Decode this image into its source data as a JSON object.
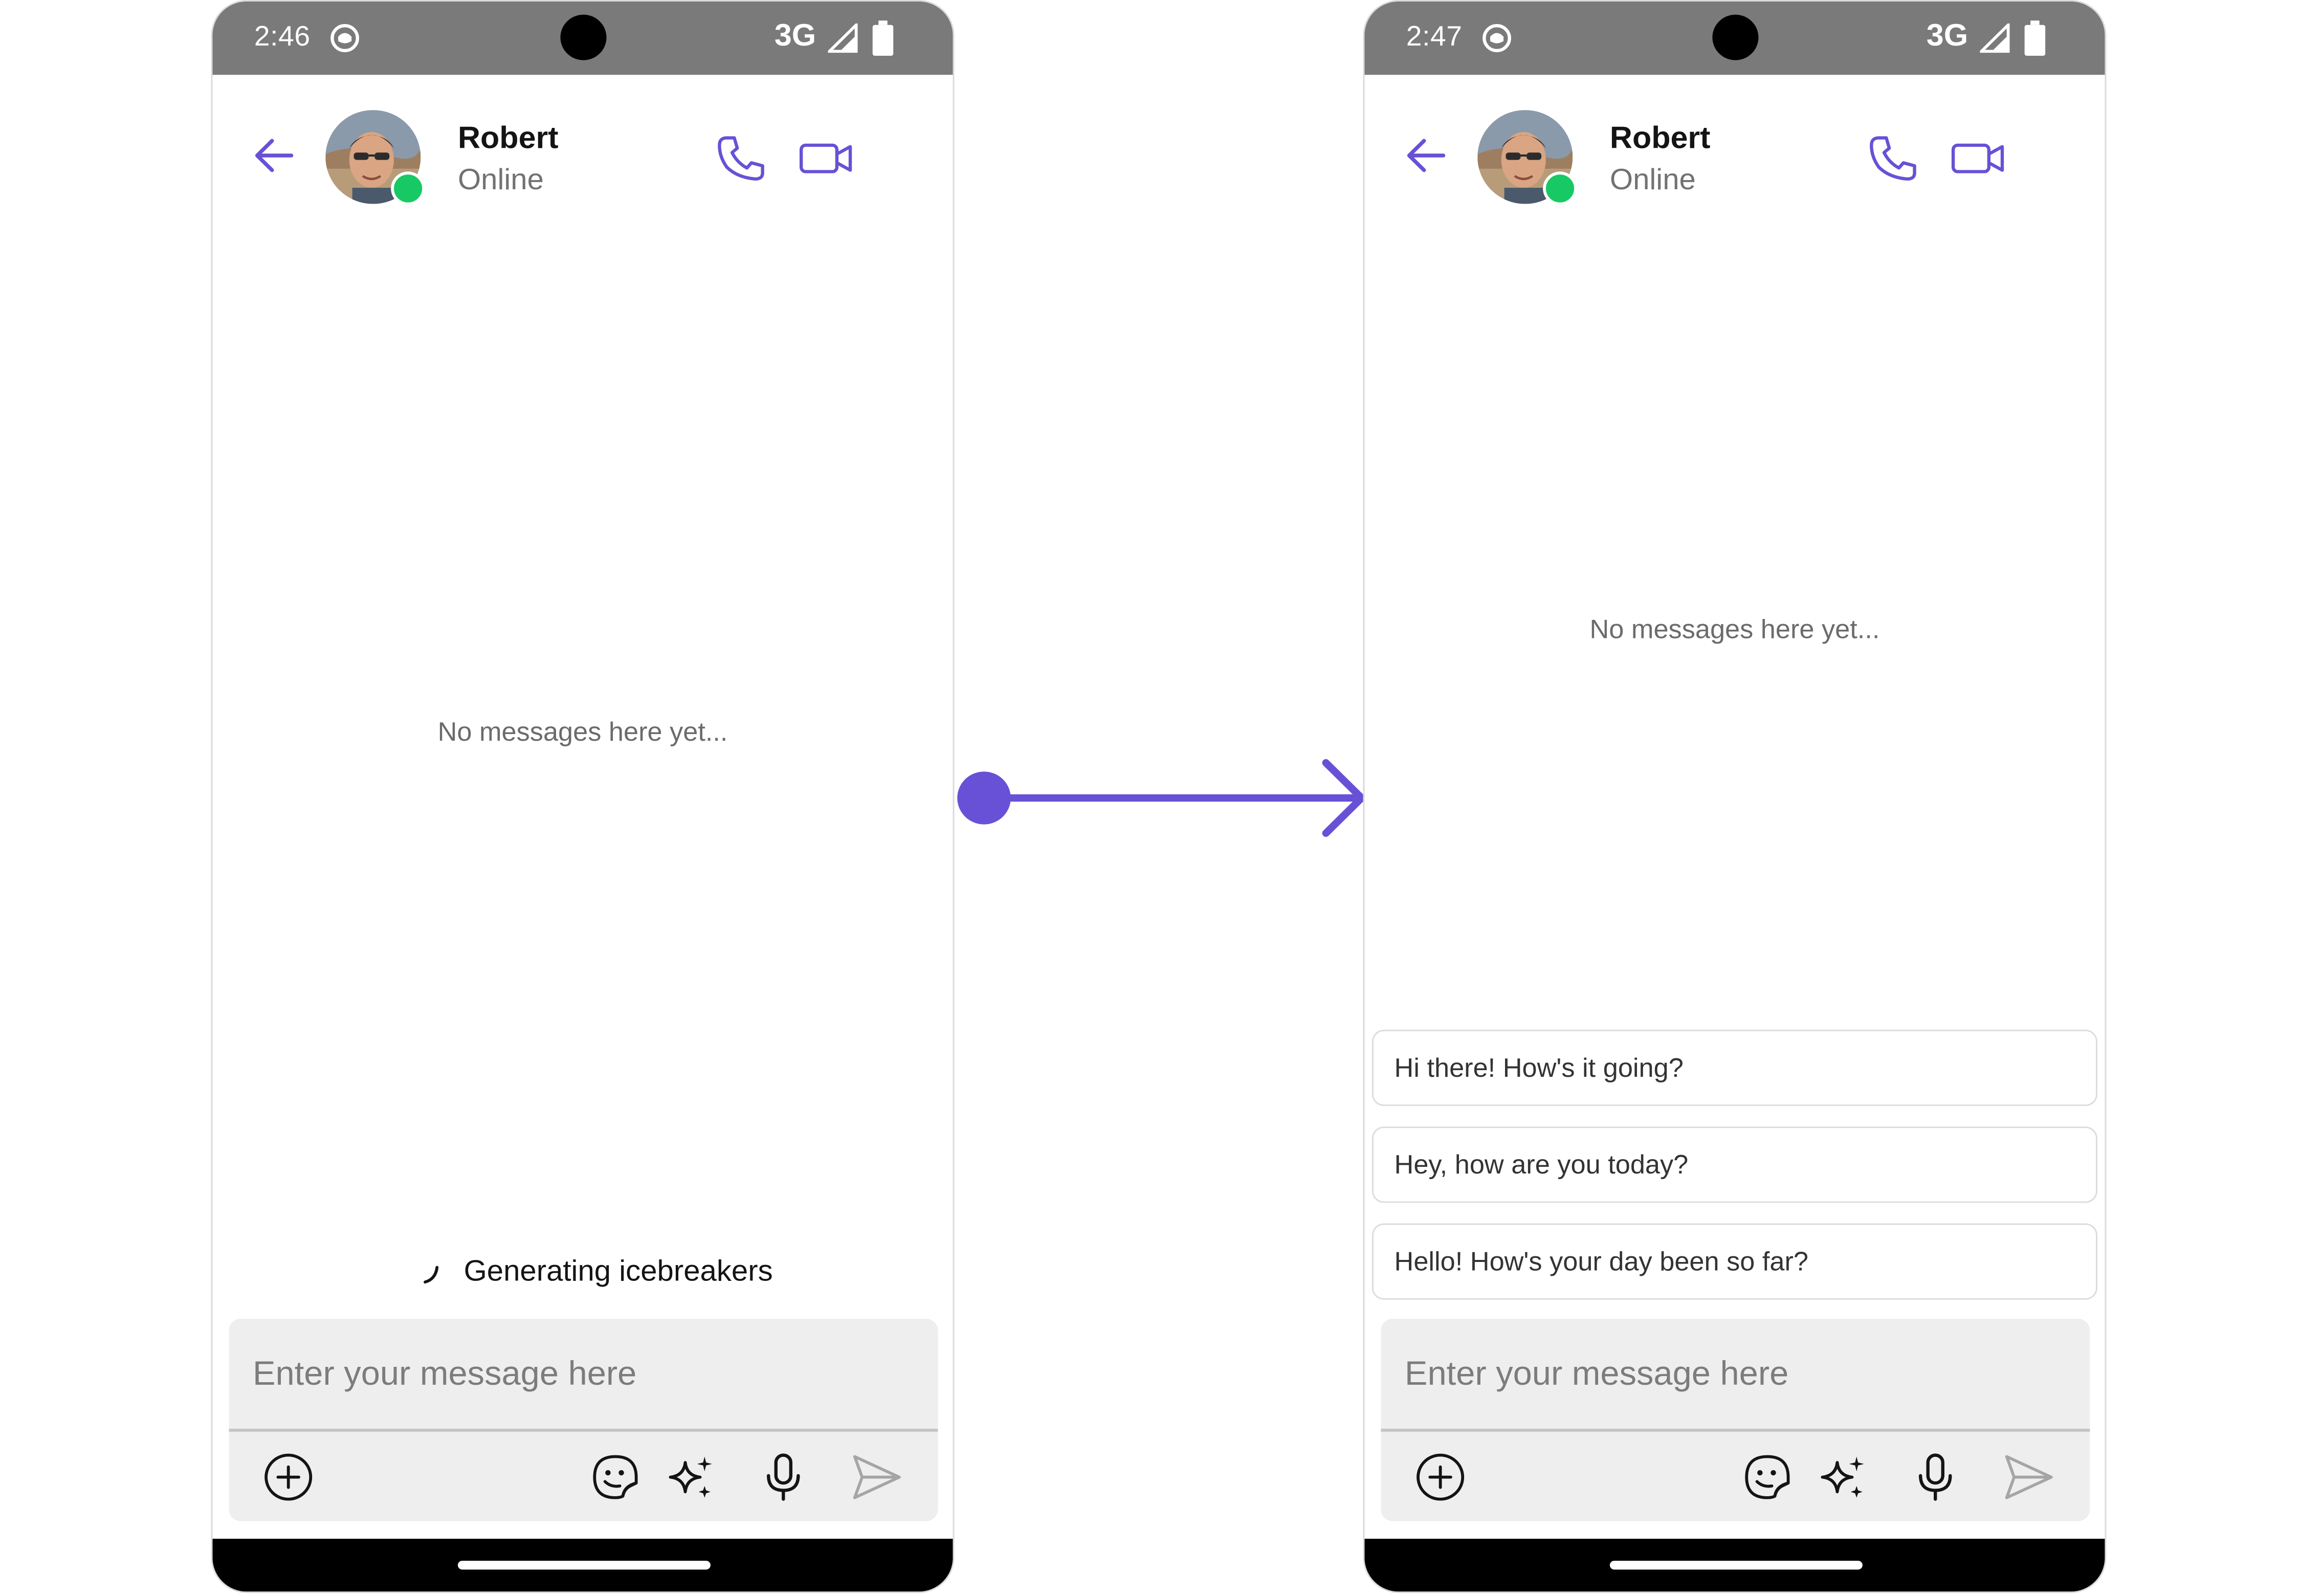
{
  "accent_color": "#6851d6",
  "online_color": "#17c964",
  "screens": [
    {
      "status_bar": {
        "time": "2:46",
        "network": "3G"
      },
      "header": {
        "contact_name": "Robert",
        "contact_status": "Online"
      },
      "empty_state": "No messages here yet...",
      "generating_text": "Generating icebreakers",
      "composer": {
        "placeholder": "Enter your message here"
      }
    },
    {
      "status_bar": {
        "time": "2:47",
        "network": "3G"
      },
      "header": {
        "contact_name": "Robert",
        "contact_status": "Online"
      },
      "empty_state": "No messages here yet...",
      "icebreakers": [
        "Hi there! How's it going?",
        "Hey, how are you today?",
        "Hello! How's your day been so far?"
      ],
      "composer": {
        "placeholder": "Enter your message here"
      }
    }
  ],
  "icons": {
    "back": "arrow-left-icon",
    "call": "phone-icon",
    "video": "video-camera-icon",
    "add": "plus-circle-icon",
    "sticker": "sticker-icon",
    "ai": "sparkles-icon",
    "mic": "microphone-icon",
    "send": "send-icon",
    "transition": "right-arrow-icon"
  }
}
